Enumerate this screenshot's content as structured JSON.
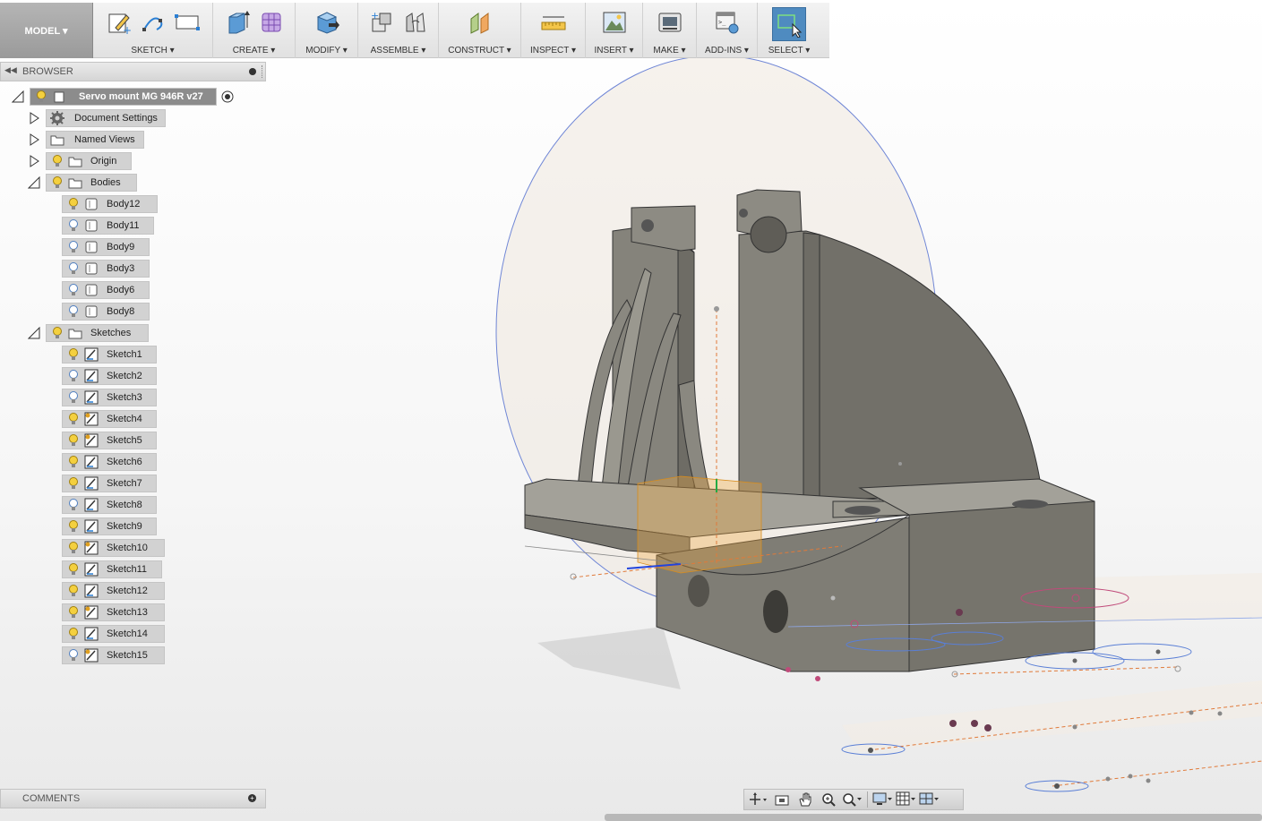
{
  "toolbar": {
    "workspace": "MODEL ▾",
    "groups": [
      {
        "label": "SKETCH ▾"
      },
      {
        "label": "CREATE ▾"
      },
      {
        "label": "MODIFY ▾"
      },
      {
        "label": "ASSEMBLE ▾"
      },
      {
        "label": "CONSTRUCT ▾"
      },
      {
        "label": "INSPECT ▾"
      },
      {
        "label": "INSERT ▾"
      },
      {
        "label": "MAKE ▾"
      },
      {
        "label": "ADD-INS ▾"
      },
      {
        "label": "SELECT ▾"
      }
    ]
  },
  "browser": {
    "title": "BROWSER",
    "root": "Servo mount MG 946R v27",
    "folders": {
      "document_settings": "Document Settings",
      "named_views": "Named Views",
      "origin": "Origin",
      "bodies": "Bodies",
      "sketches": "Sketches"
    },
    "bodies": [
      "Body12",
      "Body11",
      "Body9",
      "Body3",
      "Body6",
      "Body8"
    ],
    "sketches": [
      "Sketch1",
      "Sketch2",
      "Sketch3",
      "Sketch4",
      "Sketch5",
      "Sketch6",
      "Sketch7",
      "Sketch8",
      "Sketch9",
      "Sketch10",
      "Sketch11",
      "Sketch12",
      "Sketch13",
      "Sketch14",
      "Sketch15"
    ]
  },
  "comments": {
    "title": "COMMENTS"
  },
  "colors": {
    "accent": "#4f8bc0",
    "body_gray": "#7d7b73",
    "sketch_line": "#e07a3a",
    "construction_blue": "#5a7fd6"
  }
}
